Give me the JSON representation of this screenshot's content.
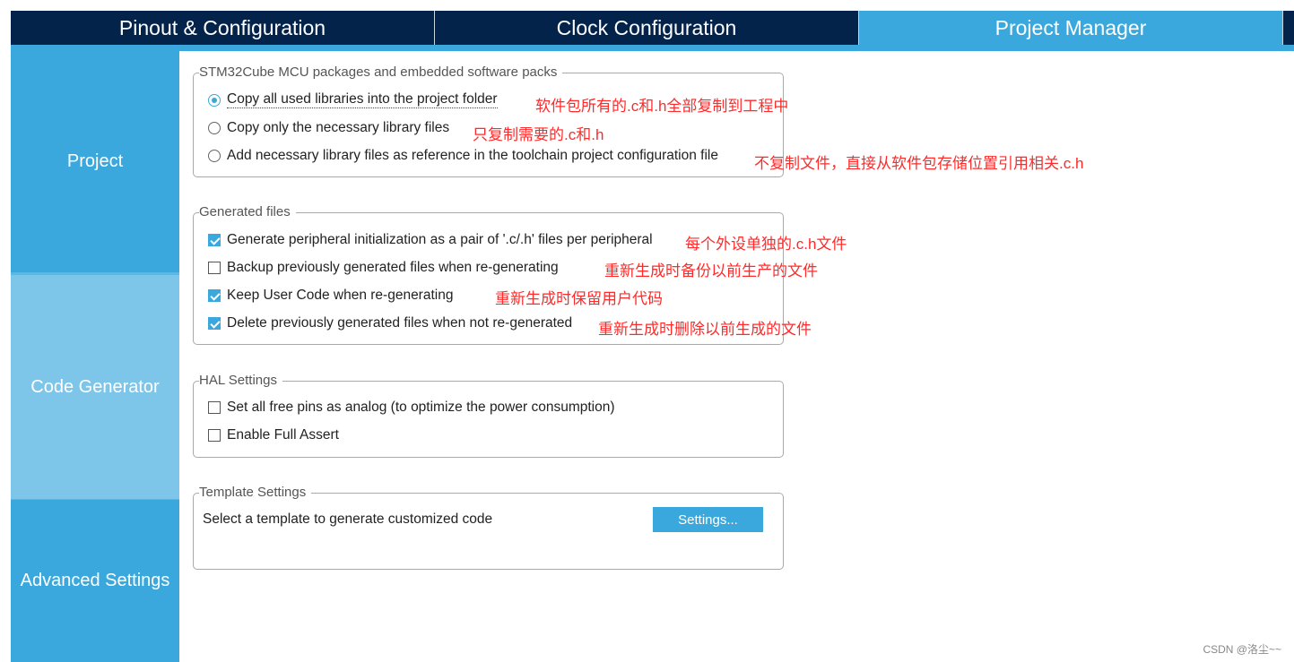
{
  "tabs": [
    {
      "label": "Pinout & Configuration"
    },
    {
      "label": "Clock Configuration"
    },
    {
      "label": "Project Manager",
      "active": true
    }
  ],
  "sidebar": {
    "items": [
      {
        "label": "Project"
      },
      {
        "label": "Code Generator",
        "active": true
      },
      {
        "label": "Advanced Settings"
      }
    ]
  },
  "packages": {
    "title": "STM32Cube MCU packages and embedded software packs",
    "options": [
      {
        "label": "Copy all used libraries into the project folder",
        "selected": true
      },
      {
        "label": "Copy only the necessary library files",
        "selected": false
      },
      {
        "label": "Add necessary library files as reference in the toolchain project configuration file",
        "selected": false
      }
    ]
  },
  "generated": {
    "title": "Generated files",
    "options": [
      {
        "label": "Generate peripheral initialization as a pair of '.c/.h' files per peripheral",
        "checked": true
      },
      {
        "label": "Backup previously generated files when re-generating",
        "checked": false
      },
      {
        "label": "Keep User Code when re-generating",
        "checked": true
      },
      {
        "label": "Delete previously generated files when not re-generated",
        "checked": true
      }
    ]
  },
  "hal": {
    "title": "HAL Settings",
    "options": [
      {
        "label": "Set all free pins as analog (to optimize the power consumption)",
        "checked": false
      },
      {
        "label": "Enable Full Assert",
        "checked": false
      }
    ]
  },
  "template": {
    "title": "Template Settings",
    "text": "Select a template to generate customized code",
    "button": "Settings..."
  },
  "annotations": [
    "软件包所有的.c和.h全部复制到工程中",
    "只复制需要的.c和.h",
    "不复制文件，直接从软件包存储位置引用相关.c.h",
    "每个外设单独的.c.h文件",
    "重新生成时备份以前生产的文件",
    "重新生成时保留用户代码",
    "重新生成时删除以前生成的文件"
  ],
  "watermark": "CSDN @洛尘~~",
  "colors": {
    "nav_dark": "#03234b",
    "accent": "#3aa8dc",
    "sidebar_active": "#7dc5e9",
    "annotation": "#ff2a2a"
  }
}
